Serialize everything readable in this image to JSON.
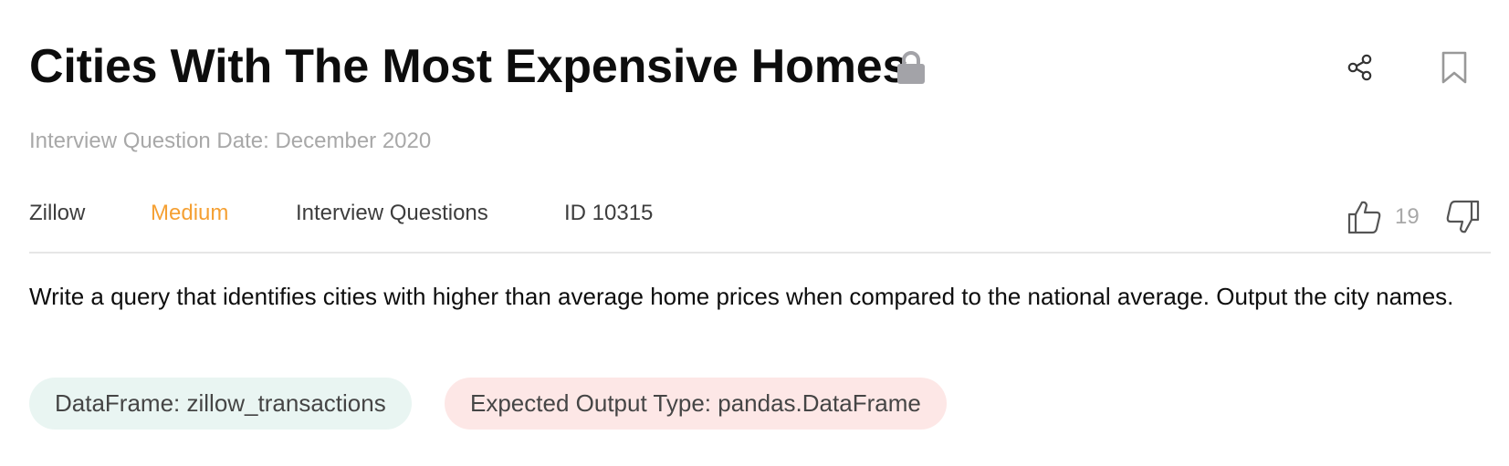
{
  "header": {
    "title": "Cities With The Most Expensive Homes",
    "icons": {
      "lock": "lock-icon",
      "share": "share-icon",
      "bookmark": "bookmark-icon"
    }
  },
  "date_text": "Interview Question Date: December 2020",
  "meta": {
    "company": "Zillow",
    "difficulty": "Medium",
    "category": "Interview Questions",
    "id_text": "ID 10315"
  },
  "votes": {
    "count": "19"
  },
  "description": "Write a query that identifies cities with higher than average home prices when compared to the national average. Output the city names.",
  "tags": {
    "dataframe": "DataFrame: zillow_transactions",
    "output_type": "Expected Output Type: pandas.DataFrame"
  },
  "colors": {
    "difficulty_medium": "#f5a033",
    "dataframe_pill_bg": "#e9f5f2",
    "output_pill_bg": "#fde7e6",
    "muted_text": "#a8a8a8"
  }
}
